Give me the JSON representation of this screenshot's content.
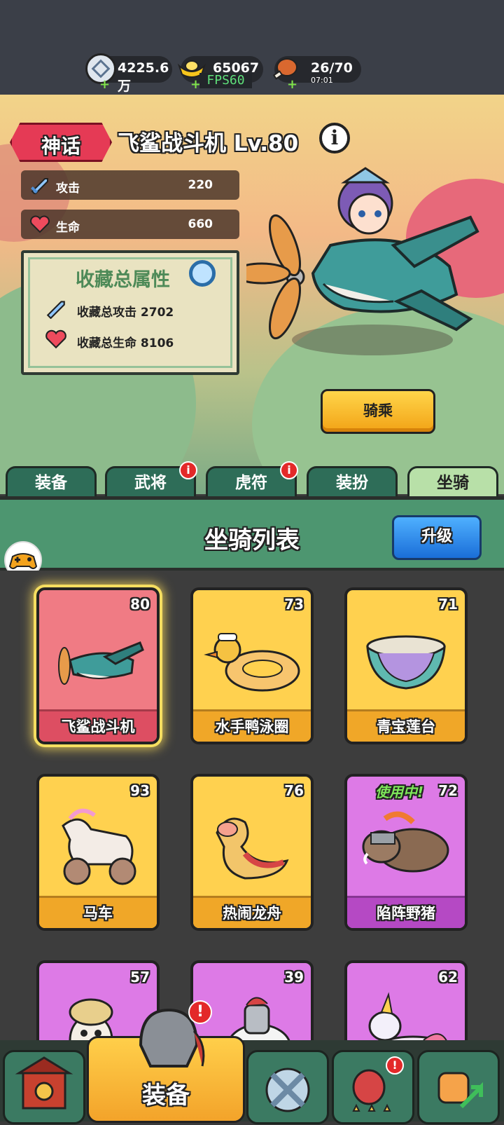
{
  "resources": {
    "silver": {
      "value": "4225.6万",
      "icon": "silver-coin-icon"
    },
    "gold": {
      "value": "65067",
      "icon": "gold-ingot-icon"
    },
    "stamina": {
      "value": "26/70",
      "timer": "07:01",
      "icon": "meat-icon"
    },
    "plus": "+",
    "fps": "FPS60"
  },
  "mount": {
    "rarity": "神话",
    "title": "飞鲨战斗机 Lv.80",
    "info": "i",
    "attack_label": "攻击",
    "attack_value": "220",
    "hp_label": "生命",
    "hp_value": "660",
    "ride_button": "骑乘"
  },
  "collection": {
    "title": "收藏总属性",
    "attack": "收藏总攻击  2702",
    "hp": "收藏总生命  8106"
  },
  "tabs": [
    {
      "label": "装备",
      "badge": false
    },
    {
      "label": "武将",
      "badge": true
    },
    {
      "label": "虎符",
      "badge": true
    },
    {
      "label": "装扮",
      "badge": false
    },
    {
      "label": "坐骑",
      "badge": false,
      "active": true
    }
  ],
  "badge_mark": "i",
  "section": {
    "title": "坐骑列表",
    "upgrade_button": "升级"
  },
  "mounts_list": [
    {
      "name": "飞鲨战斗机",
      "level": "80",
      "color": "red",
      "selected": true
    },
    {
      "name": "水手鸭泳圈",
      "level": "73",
      "color": "yellow"
    },
    {
      "name": "青宝莲台",
      "level": "71",
      "color": "yellow"
    },
    {
      "name": "马车",
      "level": "93",
      "color": "yellow"
    },
    {
      "name": "热闹龙舟",
      "level": "76",
      "color": "yellow"
    },
    {
      "name": "陷阵野猪",
      "level": "72",
      "color": "purple",
      "in_use": "使用中!"
    },
    {
      "name": "",
      "level": "57",
      "color": "purple"
    },
    {
      "name": "",
      "level": "39",
      "color": "purple"
    },
    {
      "name": "",
      "level": "62",
      "color": "purple"
    }
  ],
  "bottom_nav": {
    "equip_label": "装备",
    "alert": "!"
  },
  "colors": {
    "accent_green": "#4d9670",
    "rarity_red": "#e53a55",
    "ride_yellow": "#ffd54a",
    "upgrade_blue": "#1a6ed8"
  }
}
